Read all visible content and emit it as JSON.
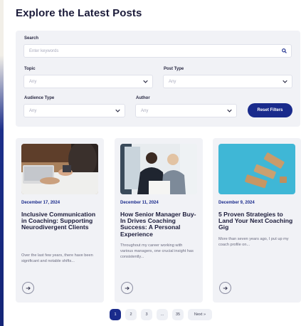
{
  "page": {
    "title": "Explore the Latest Posts"
  },
  "filters": {
    "search": {
      "label": "Search",
      "placeholder": "Enter keywords"
    },
    "topic": {
      "label": "Topic",
      "value": "Any"
    },
    "post_type": {
      "label": "Post Type",
      "value": "Any"
    },
    "audience_type": {
      "label": "Audience Type",
      "value": "Any"
    },
    "author": {
      "label": "Author",
      "value": "Any"
    },
    "reset_label": "Reset Filters"
  },
  "posts": [
    {
      "date": "December 17, 2024",
      "title": "Inclusive Communication in Coaching: Supporting Neurodivergent Clients",
      "excerpt": "Over the last few years, there have been significant and notable shifts..."
    },
    {
      "date": "December 11, 2024",
      "title": "How Senior Manager Buy-In Drives Coaching Success: A Personal Experience",
      "excerpt": "Throughout my career working with various managers, one crucial insight has consistently..."
    },
    {
      "date": "December 9, 2024",
      "title": "5 Proven Strategies to Land Your Next Coaching Gig",
      "excerpt": "More than seven years ago, I put up my coach profile on..."
    }
  ],
  "pagination": {
    "pages": [
      "1",
      "2",
      "3",
      "...",
      "35"
    ],
    "next_label": "Next »",
    "current": "1"
  },
  "icons": {
    "search": "search-icon",
    "dropdown": "chevron-down-icon",
    "read_more": "arrow-right-icon"
  },
  "colors": {
    "accent": "#1a2b8c",
    "panel_bg": "#f1f2f6",
    "heading": "#1b1b3a",
    "muted_text": "#6b6c80"
  }
}
